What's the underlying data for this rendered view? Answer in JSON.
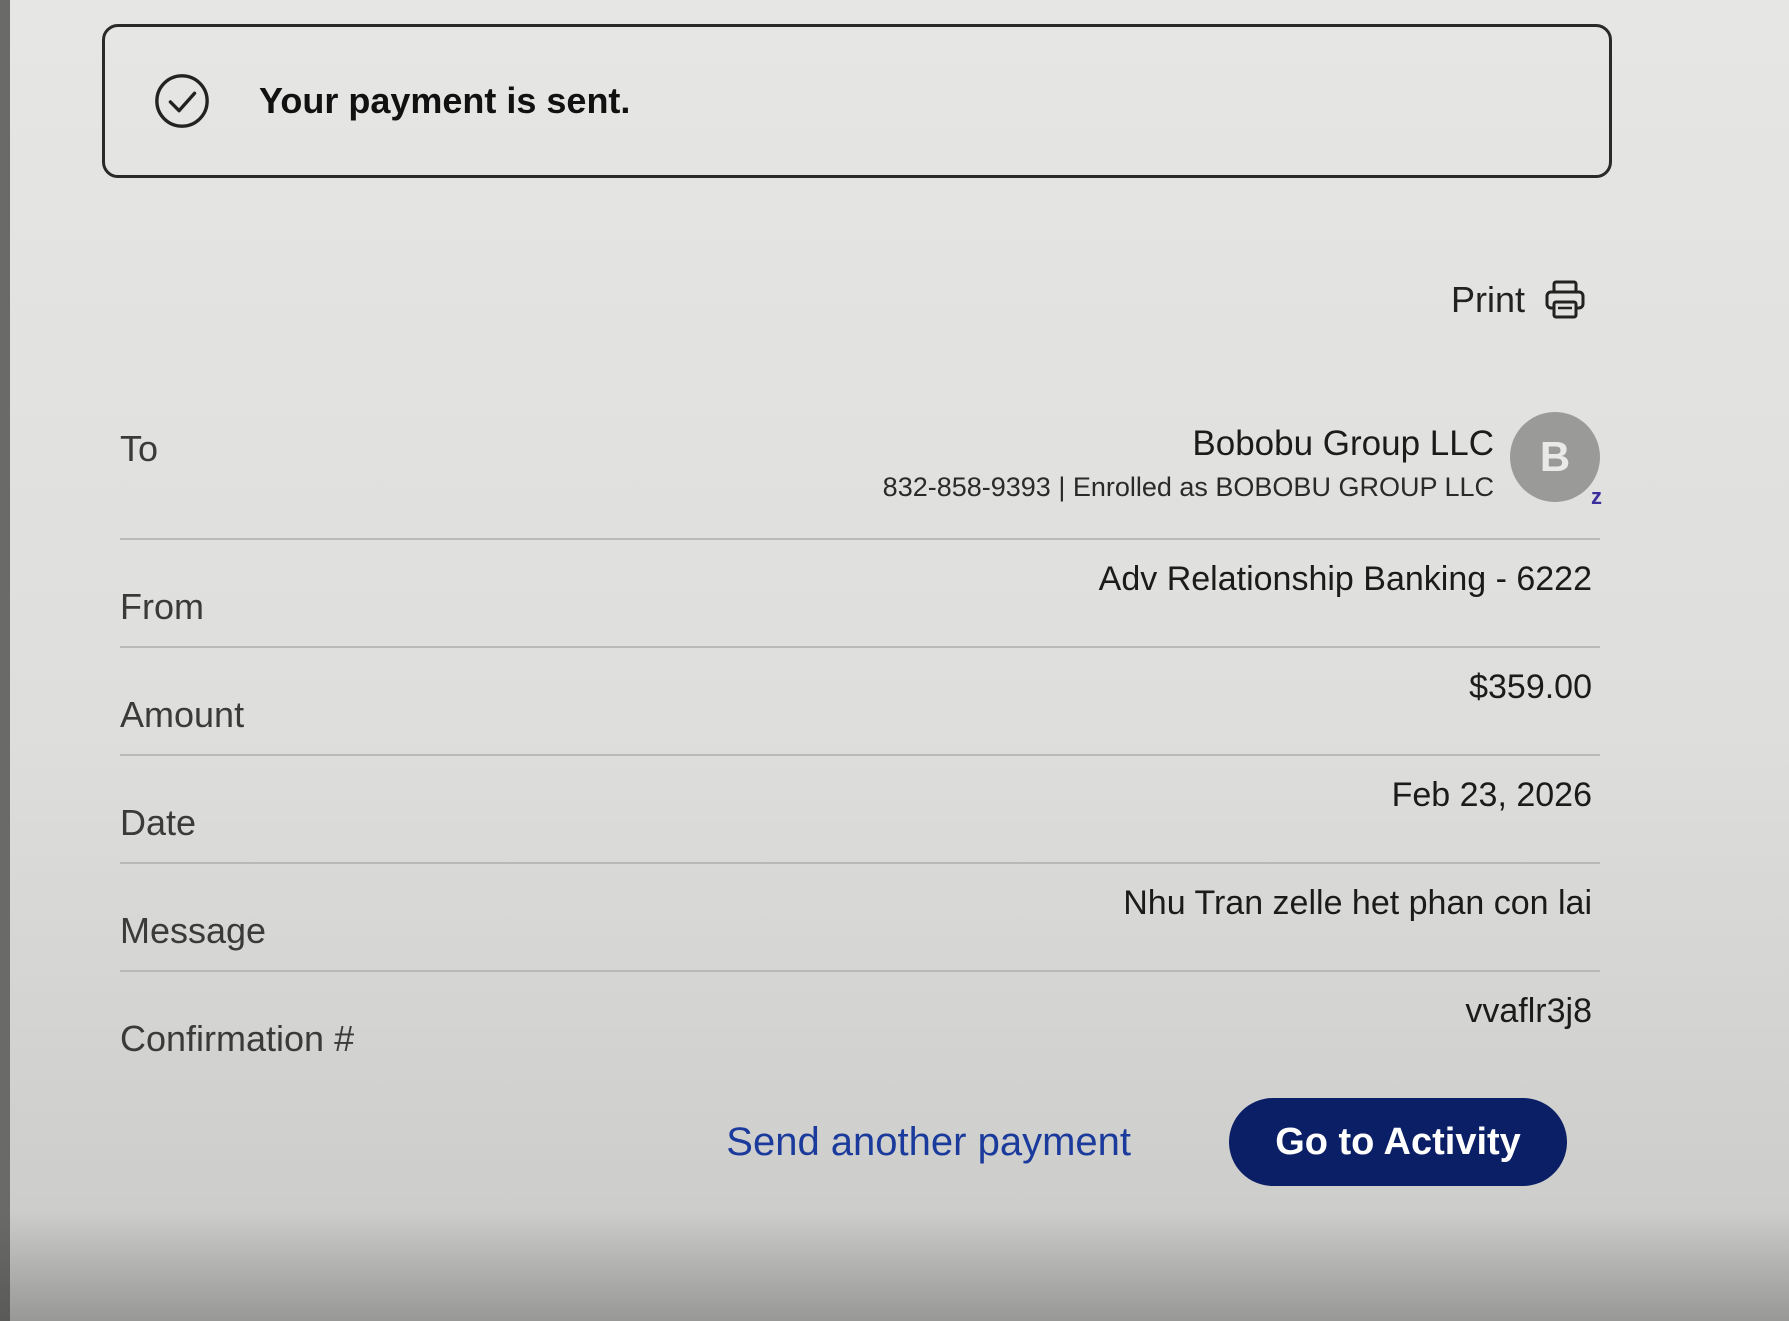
{
  "banner": {
    "icon": "check-circle-icon",
    "message": "Your payment is sent."
  },
  "print": {
    "label": "Print",
    "icon": "printer-icon"
  },
  "details": {
    "to": {
      "label": "To",
      "name": "Bobobu Group LLC",
      "sub": "832-858-9393 | Enrolled as BOBOBU GROUP LLC",
      "avatar_initial": "B",
      "badge": "z"
    },
    "from": {
      "label": "From",
      "value": "Adv Relationship Banking - 6222"
    },
    "amount": {
      "label": "Amount",
      "value": "$359.00"
    },
    "date": {
      "label": "Date",
      "value": "Feb 23, 2026"
    },
    "message": {
      "label": "Message",
      "value": "Nhu Tran zelle het phan con lai"
    },
    "confirmation": {
      "label": "Confirmation #",
      "value": "vvaflr3j8"
    }
  },
  "actions": {
    "send_another": "Send another payment",
    "go_to_activity": "Go to Activity"
  },
  "colors": {
    "primary_button": "#0b1f66",
    "link": "#1a3a9c"
  }
}
